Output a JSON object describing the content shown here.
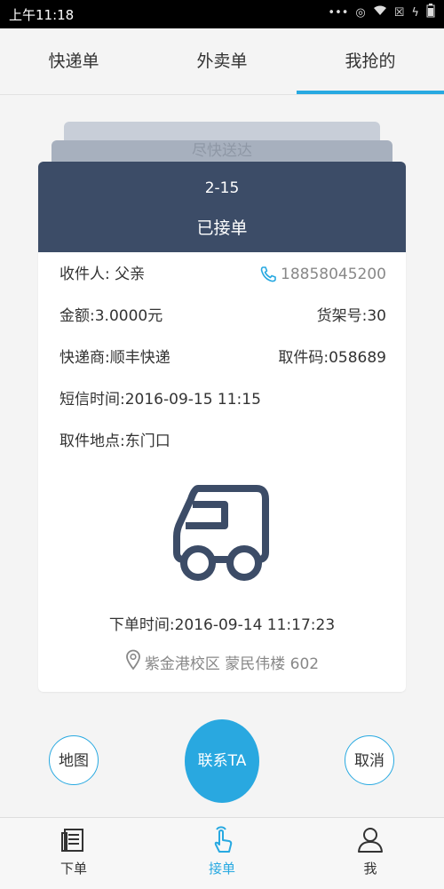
{
  "status": {
    "time": "上午11:18"
  },
  "tabs": [
    {
      "label": "快递单"
    },
    {
      "label": "外卖单"
    },
    {
      "label": "我抢的"
    }
  ],
  "ghost_card": {
    "label": "尽快送达"
  },
  "order": {
    "number": "2-15",
    "status": "已接单",
    "recipient": "收件人: 父亲",
    "phone": "18858045200",
    "amount": "金额:3.0000元",
    "shelf_no": "货架号:30",
    "courier": "快递商:顺丰快递",
    "pickup_code": "取件码:058689",
    "sms_time": "短信时间:2016-09-15 11:15",
    "pickup_location": "取件地点:东门口",
    "order_time": "下单时间:2016-09-14 11:17:23",
    "address": "紫金港校区 蒙民伟楼 602"
  },
  "actions": {
    "map": "地图",
    "contact": "联系TA",
    "cancel": "取消"
  },
  "bottom_nav": [
    {
      "label": "下单",
      "icon": "document-icon"
    },
    {
      "label": "接单",
      "icon": "tap-hand-icon"
    },
    {
      "label": "我",
      "icon": "person-icon"
    }
  ],
  "colors": {
    "accent": "#28a9e1",
    "header": "#3c4c67",
    "truck": "#3c4c67"
  }
}
